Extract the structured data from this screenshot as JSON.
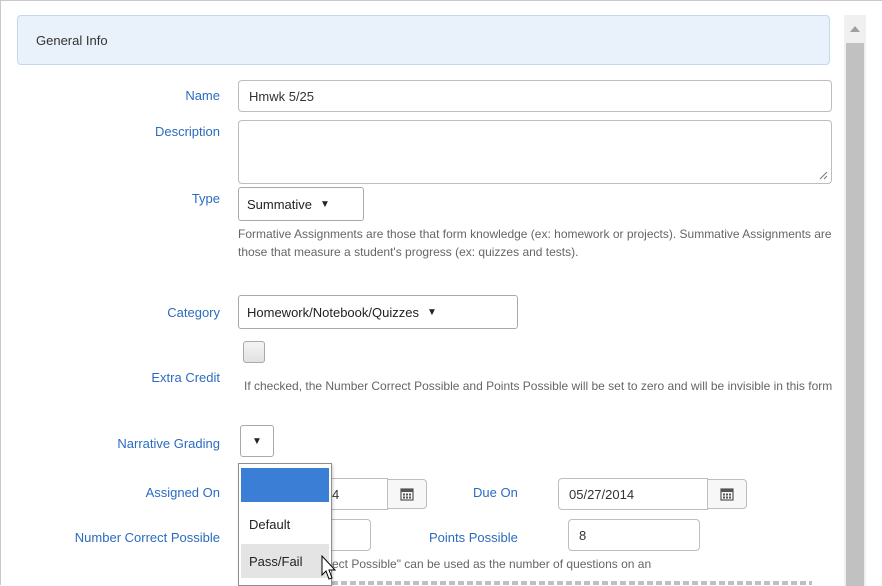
{
  "panel": {
    "title": "General Info"
  },
  "name": {
    "label": "Name",
    "value": "Hmwk 5/25"
  },
  "description": {
    "label": "Description",
    "value": ""
  },
  "type": {
    "label": "Type",
    "selected": "Summative",
    "help": "Formative Assignments are those that form knowledge (ex: homework or projects). Summative Assignments are those that measure a student's progress (ex: quizzes and tests)."
  },
  "category": {
    "label": "Category",
    "selected": "Homework/Notebook/Quizzes"
  },
  "extra_credit": {
    "label": "Extra Credit",
    "checked": false,
    "help": "If checked, the Number Correct Possible and Points Possible will be set to zero and will be invisible in this form"
  },
  "narrative_grading": {
    "label": "Narrative Grading",
    "selected": "",
    "options": [
      "",
      "Default",
      "Pass/Fail"
    ]
  },
  "assigned_on": {
    "label": "Assigned On",
    "value_visible": "4"
  },
  "due_on": {
    "label": "Due On",
    "value": "05/27/2014"
  },
  "number_correct_possible": {
    "label": "Number Correct Possible",
    "value": ""
  },
  "points_possible": {
    "label": "Points Possible",
    "value": "8"
  },
  "bottom_help": {
    "line1": "ect Possible\" can be used as the number of questions on an"
  },
  "icons": {
    "calendar": "calendar-icon",
    "scroll_up": "scroll-up-arrow-icon",
    "cursor": "mouse-pointer-icon"
  },
  "colors": {
    "label": "#2b6cbf",
    "header_bg": "#e9f1fb",
    "selected_option": "#3a7fd5"
  }
}
